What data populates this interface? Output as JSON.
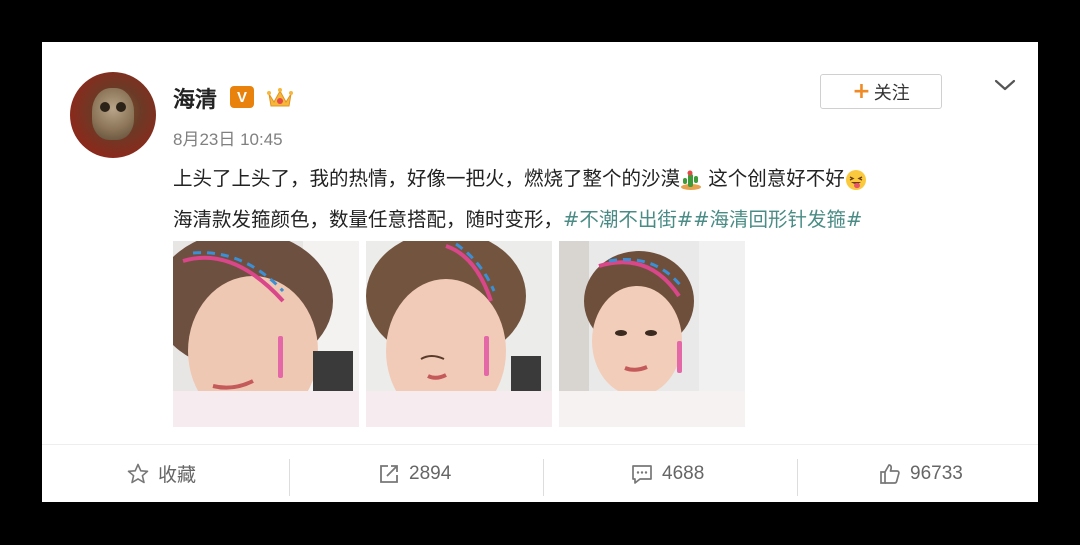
{
  "post": {
    "username": "海清",
    "verified_badge": "V",
    "time": "8月23日 10:45",
    "follow_label": "关注",
    "lines": {
      "line1_text": "上头了上头了，我的热情，好像一把火，燃烧了整个的沙漠",
      "line1_text2": " 这个创意好不好",
      "line2_text": "海清款发箍颜色，数量任意搭配，随时变形，",
      "hashtag1": "#不潮不出街#",
      "hashtag2": "#海清回形针发箍#"
    },
    "icons": {
      "badge": "verified-v-icon",
      "crown": "crown-emoji-icon",
      "more": "chevron-down-icon",
      "cactus": "cactus-emoji-icon",
      "tongue": "tongue-face-emoji-icon"
    }
  },
  "actions": {
    "favorite_label": "收藏",
    "repost_count": "2894",
    "comment_count": "4688",
    "like_count": "96733"
  },
  "colors": {
    "hashtag": "#4a8c85",
    "follow_plus": "#f08a24",
    "badge": "#e8820c",
    "background": "#000000",
    "card": "#ffffff"
  }
}
